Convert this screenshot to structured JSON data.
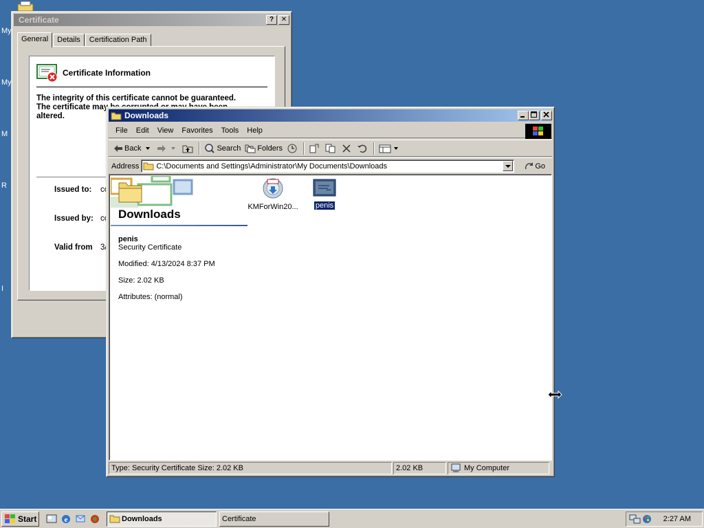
{
  "desktop": {
    "labels": [
      "My",
      "My",
      "M",
      "R",
      "I"
    ]
  },
  "certificate_window": {
    "title": "Certificate",
    "help_btn": "?",
    "close_btn": "✕",
    "tabs": [
      {
        "label": "General"
      },
      {
        "label": "Details"
      },
      {
        "label": "Certification Path"
      }
    ],
    "info_heading": "Certificate Information",
    "warning_line1": "The integrity of this certificate cannot be guaranteed.",
    "warning_line2": "The certificate may be corrupted or may have been",
    "warning_line3": "altered.",
    "fields": [
      {
        "label": "Issued to:",
        "value": "co"
      },
      {
        "label": "Issued by:",
        "value": "co"
      },
      {
        "label": "Valid from",
        "value": "3/"
      }
    ]
  },
  "explorer_window": {
    "title": "Downloads",
    "menu": [
      "File",
      "Edit",
      "View",
      "Favorites",
      "Tools",
      "Help"
    ],
    "toolbar": {
      "back": "Back",
      "search": "Search",
      "folders": "Folders"
    },
    "address": {
      "label": "Address",
      "value": "C:\\Documents and Settings\\Administrator\\My Documents\\Downloads",
      "go": "Go"
    },
    "banner_title": "Downloads",
    "details": {
      "name": "penis",
      "type": "Security Certificate",
      "modified": "Modified: 4/13/2024 8:37 PM",
      "size": "Size: 2.02 KB",
      "attributes": "Attributes: (normal)"
    },
    "files": [
      {
        "label": "KMForWin20..."
      },
      {
        "label": "penis"
      }
    ],
    "status": {
      "info": "Type: Security Certificate Size: 2.02 KB",
      "size": "2.02 KB",
      "zone": "My Computer"
    }
  },
  "taskbar": {
    "start": "Start",
    "tasks": [
      {
        "label": "Downloads"
      },
      {
        "label": "Certificate"
      }
    ],
    "clock": "2:27 AM"
  }
}
